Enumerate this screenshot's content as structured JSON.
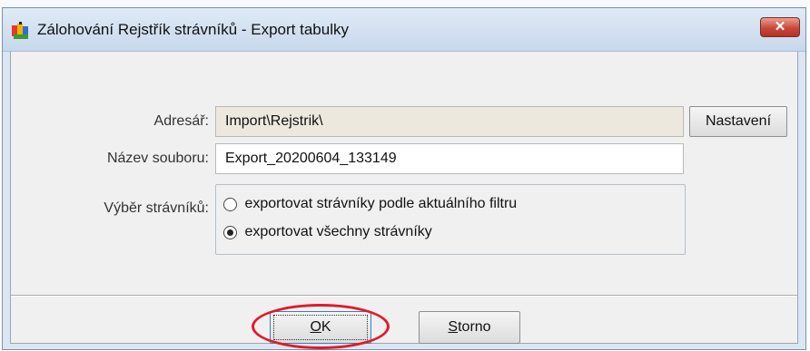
{
  "window": {
    "title": "Zálohování Rejstřík strávníků - Export tabulky",
    "close_symbol": "✕",
    "icon": "application-icon",
    "close_color": "#c7483a"
  },
  "form": {
    "directory_label": "Adresář:",
    "directory_value": "Import\\Rejstrik\\",
    "settings_button": "Nastavení",
    "filename_label": "Název souboru:",
    "filename_value": "Export_20200604_133149"
  },
  "selection": {
    "label": "Výběr strávníků:",
    "options": [
      {
        "label": "exportovat strávníky podle aktuálního filtru",
        "checked": false
      },
      {
        "label": "exportovat všechny strávníky",
        "checked": true
      }
    ]
  },
  "buttons": {
    "ok_mnemonic": "O",
    "ok_rest": "K",
    "cancel_mnemonic": "S",
    "cancel_rest": "torno"
  },
  "annotation": {
    "color": "#e11a2a",
    "target": "ok-button"
  }
}
